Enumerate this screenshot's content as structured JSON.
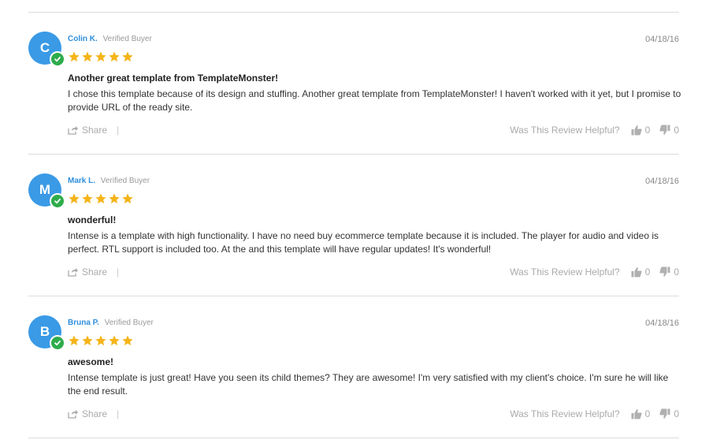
{
  "share_label": "Share",
  "separator": "|",
  "helpful_label": "Was This Review Helpful?",
  "verified_label": "Verified Buyer",
  "colors": {
    "avatar": "#3a9ae6",
    "verified_check": "#2eac4b",
    "author": "#2f8fdc",
    "star": "#f4b41a"
  },
  "reviews": [
    {
      "initial": "C",
      "author": "Colin K.",
      "date": "04/18/16",
      "rating": 5,
      "title": "Another great template from TemplateMonster!",
      "body": "I chose this template because of its design and stuffing. Another great template from TemplateMonster! I haven't worked with it yet, but I promise to provide URL of the ready site.",
      "helpful_up": "0",
      "helpful_down": "0"
    },
    {
      "initial": "M",
      "author": "Mark L.",
      "date": "04/18/16",
      "rating": 5,
      "title": "wonderful!",
      "body": "Intense is a template with high functionality. I have no need buy ecommerce template because it is included. The player for audio and video is perfect. RTL support is included too. At the and this template will have regular updates! It's wonderful!",
      "helpful_up": "0",
      "helpful_down": "0"
    },
    {
      "initial": "B",
      "author": "Bruna P.",
      "date": "04/18/16",
      "rating": 5,
      "title": "awesome!",
      "body": "Intense template is just great! Have you seen its child themes? They are awesome! I'm very satisfied with my client's choice. I'm sure he will like the end result.",
      "helpful_up": "0",
      "helpful_down": "0"
    }
  ]
}
